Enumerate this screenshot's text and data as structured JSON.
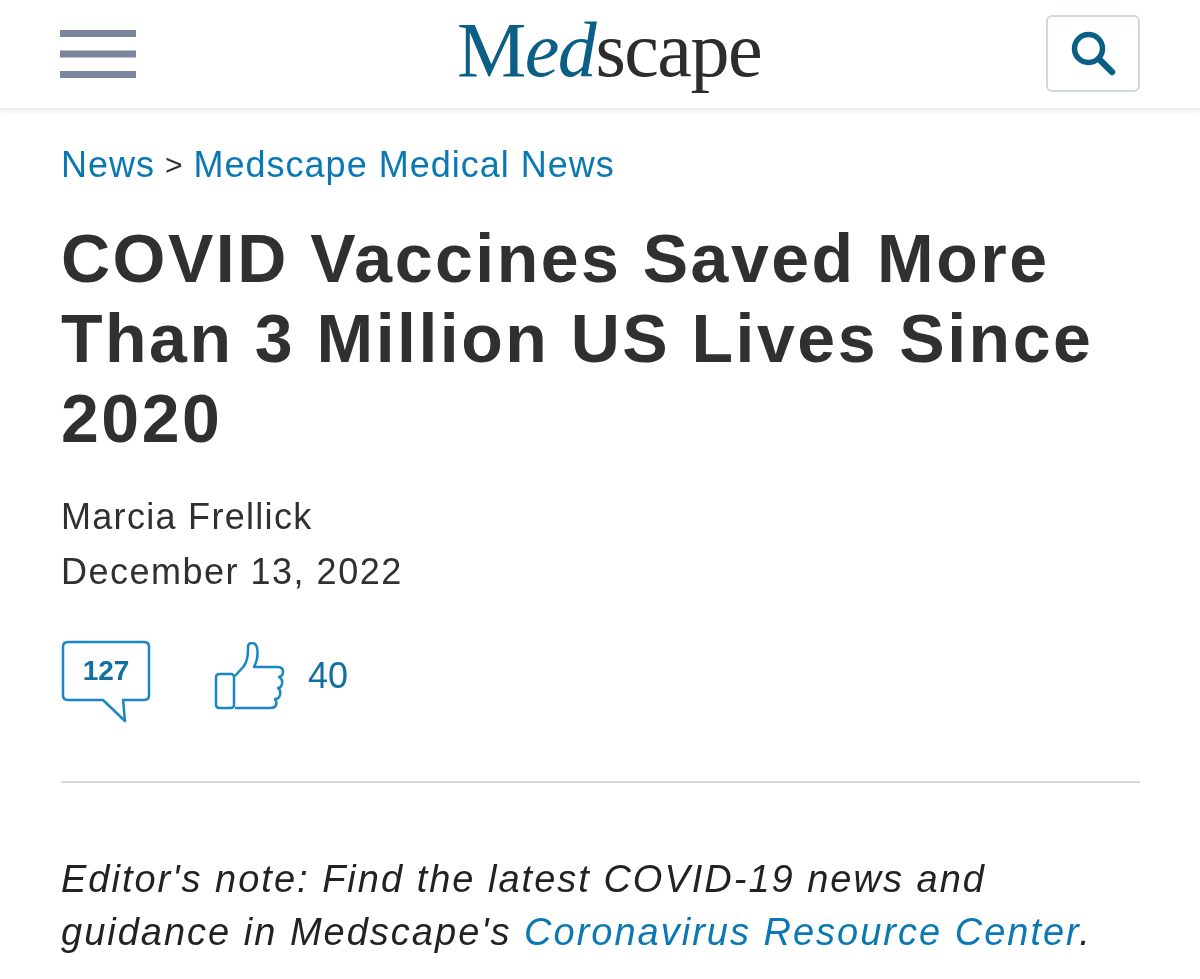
{
  "header": {
    "logo": [
      "M",
      "ed",
      "scape"
    ]
  },
  "breadcrumb": [
    {
      "label": "News",
      "kind": "link"
    },
    {
      "label": ">",
      "kind": "separator"
    },
    {
      "label": "Medscape Medical News",
      "kind": "link"
    }
  ],
  "article": {
    "title": "COVID Vaccines Saved More Than 3 Million US Lives Since 2020",
    "author": "Marcia Frellick",
    "date": "December 13, 2022",
    "comments": {
      "count": "127"
    },
    "likes": {
      "count": "40"
    },
    "editors_note": {
      "text": "Editor's note: Find the latest COVID-19 news and guidance in Medscape's ",
      "link": "Coronavirus Resource Center",
      "end": "."
    }
  }
}
